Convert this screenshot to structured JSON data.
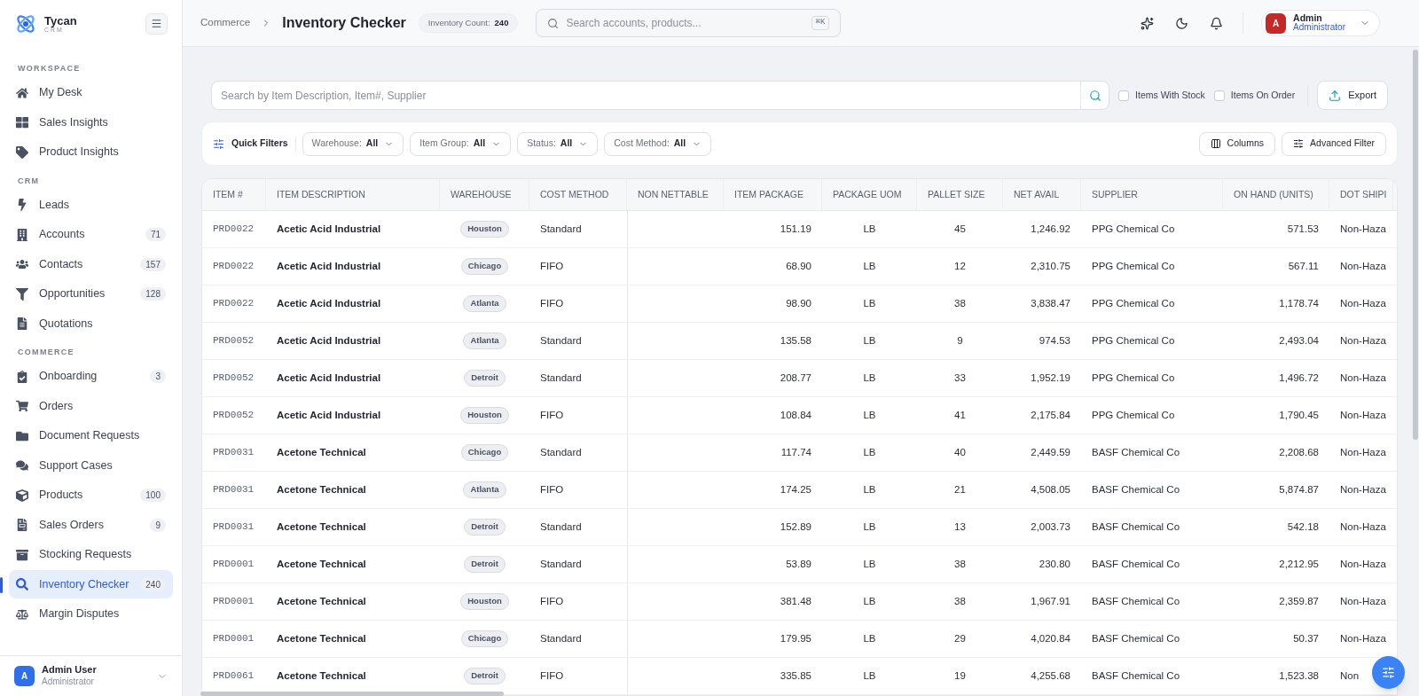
{
  "brand": {
    "name": "Tycan",
    "tagline": "CRM"
  },
  "sidebar": {
    "sections": [
      {
        "title": "WORKSPACE",
        "items": [
          {
            "label": "My Desk",
            "selected": false
          },
          {
            "label": "Sales Insights",
            "selected": false
          },
          {
            "label": "Product Insights",
            "selected": false
          }
        ]
      },
      {
        "title": "CRM",
        "items": [
          {
            "label": "Leads",
            "selected": false
          },
          {
            "label": "Accounts",
            "badge": "71",
            "selected": false
          },
          {
            "label": "Contacts",
            "badge": "157",
            "selected": false
          },
          {
            "label": "Opportunities",
            "badge": "128",
            "selected": false
          },
          {
            "label": "Quotations",
            "selected": false
          }
        ]
      },
      {
        "title": "COMMERCE",
        "items": [
          {
            "label": "Onboarding",
            "badge": "3",
            "selected": false
          },
          {
            "label": "Orders",
            "selected": false
          },
          {
            "label": "Document Requests",
            "selected": false
          },
          {
            "label": "Support Cases",
            "selected": false
          },
          {
            "label": "Products",
            "badge": "100",
            "selected": false
          },
          {
            "label": "Sales Orders",
            "badge": "9",
            "selected": false
          },
          {
            "label": "Stocking Requests",
            "selected": false
          },
          {
            "label": "Inventory Checker",
            "badge": "240",
            "selected": true
          },
          {
            "label": "Margin Disputes",
            "selected": false
          }
        ]
      }
    ],
    "user": {
      "initial": "A",
      "name": "Admin User",
      "role": "Administrator"
    }
  },
  "header": {
    "breadcrumb": "Commerce",
    "title": "Inventory Checker",
    "count_label": "Inventory Count:",
    "count": "240",
    "search": {
      "placeholder": "Search accounts, products...",
      "shortcut": "⌘K"
    },
    "user": {
      "initial": "A",
      "name": "Admin",
      "role": "Administrator"
    }
  },
  "toolbar": {
    "search": {
      "placeholder": "Search by Item Description, Item#, Supplier"
    },
    "checkboxes": [
      {
        "label": "Items With Stock",
        "checked": false
      },
      {
        "label": "Items On Order",
        "checked": false
      }
    ],
    "export": "Export"
  },
  "filters": {
    "title": "Quick Filters",
    "dropdowns": [
      {
        "label": "Warehouse:",
        "value": "All"
      },
      {
        "label": "Item Group:",
        "value": "All"
      },
      {
        "label": "Status:",
        "value": "All"
      },
      {
        "label": "Cost Method:",
        "value": "All"
      }
    ],
    "columns_button": "Columns",
    "advanced_button": "Advanced Filter"
  },
  "table": {
    "columns": [
      "ITEM #",
      "ITEM DESCRIPTION",
      "WAREHOUSE",
      "COST METHOD",
      "NON NETTABLE",
      "ITEM PACKAGE",
      "PACKAGE UOM",
      "PALLET SIZE",
      "NET AVAIL",
      "SUPPLIER",
      "ON HAND (UNITS)",
      "DOT SHIPI"
    ],
    "rows": [
      [
        "PRD0022",
        "Acetic Acid Industrial",
        "Houston",
        "Standard",
        "",
        "151.19",
        "LB",
        "45",
        "1,246.92",
        "PPG Chemical Co",
        "571.53",
        "Non-Haza"
      ],
      [
        "PRD0022",
        "Acetic Acid Industrial",
        "Chicago",
        "FIFO",
        "",
        "68.90",
        "LB",
        "12",
        "2,310.75",
        "PPG Chemical Co",
        "567.11",
        "Non-Haza"
      ],
      [
        "PRD0022",
        "Acetic Acid Industrial",
        "Atlanta",
        "FIFO",
        "",
        "98.90",
        "LB",
        "38",
        "3,838.47",
        "PPG Chemical Co",
        "1,178.74",
        "Non-Haza"
      ],
      [
        "PRD0052",
        "Acetic Acid Industrial",
        "Atlanta",
        "Standard",
        "",
        "135.58",
        "LB",
        "9",
        "974.53",
        "PPG Chemical Co",
        "2,493.04",
        "Non-Haza"
      ],
      [
        "PRD0052",
        "Acetic Acid Industrial",
        "Detroit",
        "Standard",
        "",
        "208.77",
        "LB",
        "33",
        "1,952.19",
        "PPG Chemical Co",
        "1,496.72",
        "Non-Haza"
      ],
      [
        "PRD0052",
        "Acetic Acid Industrial",
        "Houston",
        "FIFO",
        "",
        "108.84",
        "LB",
        "41",
        "2,175.84",
        "PPG Chemical Co",
        "1,790.45",
        "Non-Haza"
      ],
      [
        "PRD0031",
        "Acetone Technical",
        "Chicago",
        "Standard",
        "",
        "117.74",
        "LB",
        "40",
        "2,449.59",
        "BASF Chemical Co",
        "2,208.68",
        "Non-Haza"
      ],
      [
        "PRD0031",
        "Acetone Technical",
        "Atlanta",
        "FIFO",
        "",
        "174.25",
        "LB",
        "21",
        "4,508.05",
        "BASF Chemical Co",
        "5,874.87",
        "Non-Haza"
      ],
      [
        "PRD0031",
        "Acetone Technical",
        "Detroit",
        "Standard",
        "",
        "152.89",
        "LB",
        "13",
        "2,003.73",
        "BASF Chemical Co",
        "542.18",
        "Non-Haza"
      ],
      [
        "PRD0001",
        "Acetone Technical",
        "Detroit",
        "Standard",
        "",
        "53.89",
        "LB",
        "38",
        "230.80",
        "BASF Chemical Co",
        "2,212.95",
        "Non-Haza"
      ],
      [
        "PRD0001",
        "Acetone Technical",
        "Houston",
        "FIFO",
        "",
        "381.48",
        "LB",
        "38",
        "1,967.91",
        "BASF Chemical Co",
        "2,359.87",
        "Non-Haza"
      ],
      [
        "PRD0001",
        "Acetone Technical",
        "Chicago",
        "Standard",
        "",
        "179.95",
        "LB",
        "29",
        "4,020.84",
        "BASF Chemical Co",
        "50.37",
        "Non-Haza"
      ],
      [
        "PRD0061",
        "Acetone Technical",
        "Detroit",
        "FIFO",
        "",
        "335.85",
        "LB",
        "19",
        "4,255.68",
        "BASF Chemical Co",
        "1,523.38",
        "Non"
      ]
    ]
  }
}
